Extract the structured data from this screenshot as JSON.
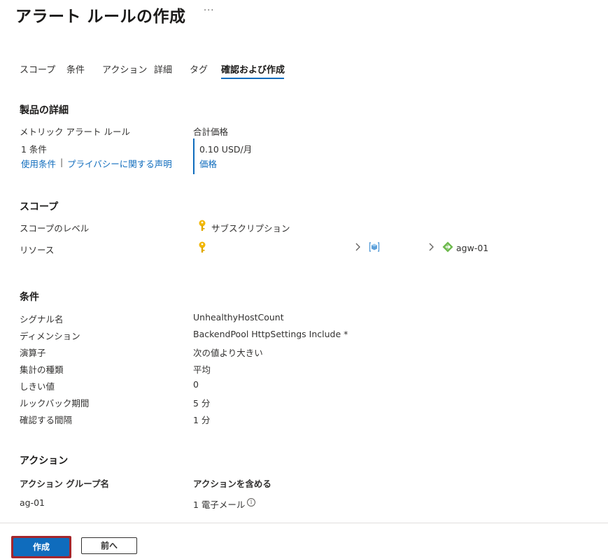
{
  "header": {
    "title": "アラート ルールの作成",
    "ellipsis": "···"
  },
  "tabs": [
    {
      "label": "スコープ"
    },
    {
      "label": "条件"
    },
    {
      "label": "アクション"
    },
    {
      "label": "詳細"
    },
    {
      "label": "タグ"
    },
    {
      "label": "確認および作成",
      "active": true
    }
  ],
  "product": {
    "section_title": "製品の詳細",
    "name": "メトリック アラート ルール",
    "count": "1 条件",
    "terms_link": "使用条件",
    "separator": "|",
    "privacy_link": "プライバシーに関する声明",
    "price_header": "合計価格",
    "price_value": "0.10 USD/月",
    "price_link": "価格"
  },
  "scope": {
    "section_title": "スコープ",
    "level_label": "スコープのレベル",
    "level_value": "サブスクリプション",
    "resource_label": "リソース",
    "resource_name": "agw-01"
  },
  "condition": {
    "section_title": "条件",
    "rows": [
      {
        "label": "シグナル名",
        "value": "UnhealthyHostCount"
      },
      {
        "label": "ディメンション",
        "value": "BackendPool HttpSettings Include *"
      },
      {
        "label": "演算子",
        "value": "次の値より大きい"
      },
      {
        "label": "集計の種類",
        "value": "平均"
      },
      {
        "label": "しきい値",
        "value": "0"
      },
      {
        "label": "ルックバック期間",
        "value": "5 分"
      },
      {
        "label": "確認する間隔",
        "value": "1 分"
      }
    ]
  },
  "actions": {
    "section_title": "アクション",
    "col_group": "アクション グループ名",
    "col_include": "アクションを含める",
    "group_name": "ag-01",
    "include_value": "1 電子メール"
  },
  "footer": {
    "create_label": "作成",
    "back_label": "前へ"
  },
  "colors": {
    "accent": "#0f6cbd",
    "highlight": "#a4262c",
    "key": "#f2b705",
    "resource_icon": "#5ea0d9",
    "gateway_icon": "#6bb84a"
  }
}
